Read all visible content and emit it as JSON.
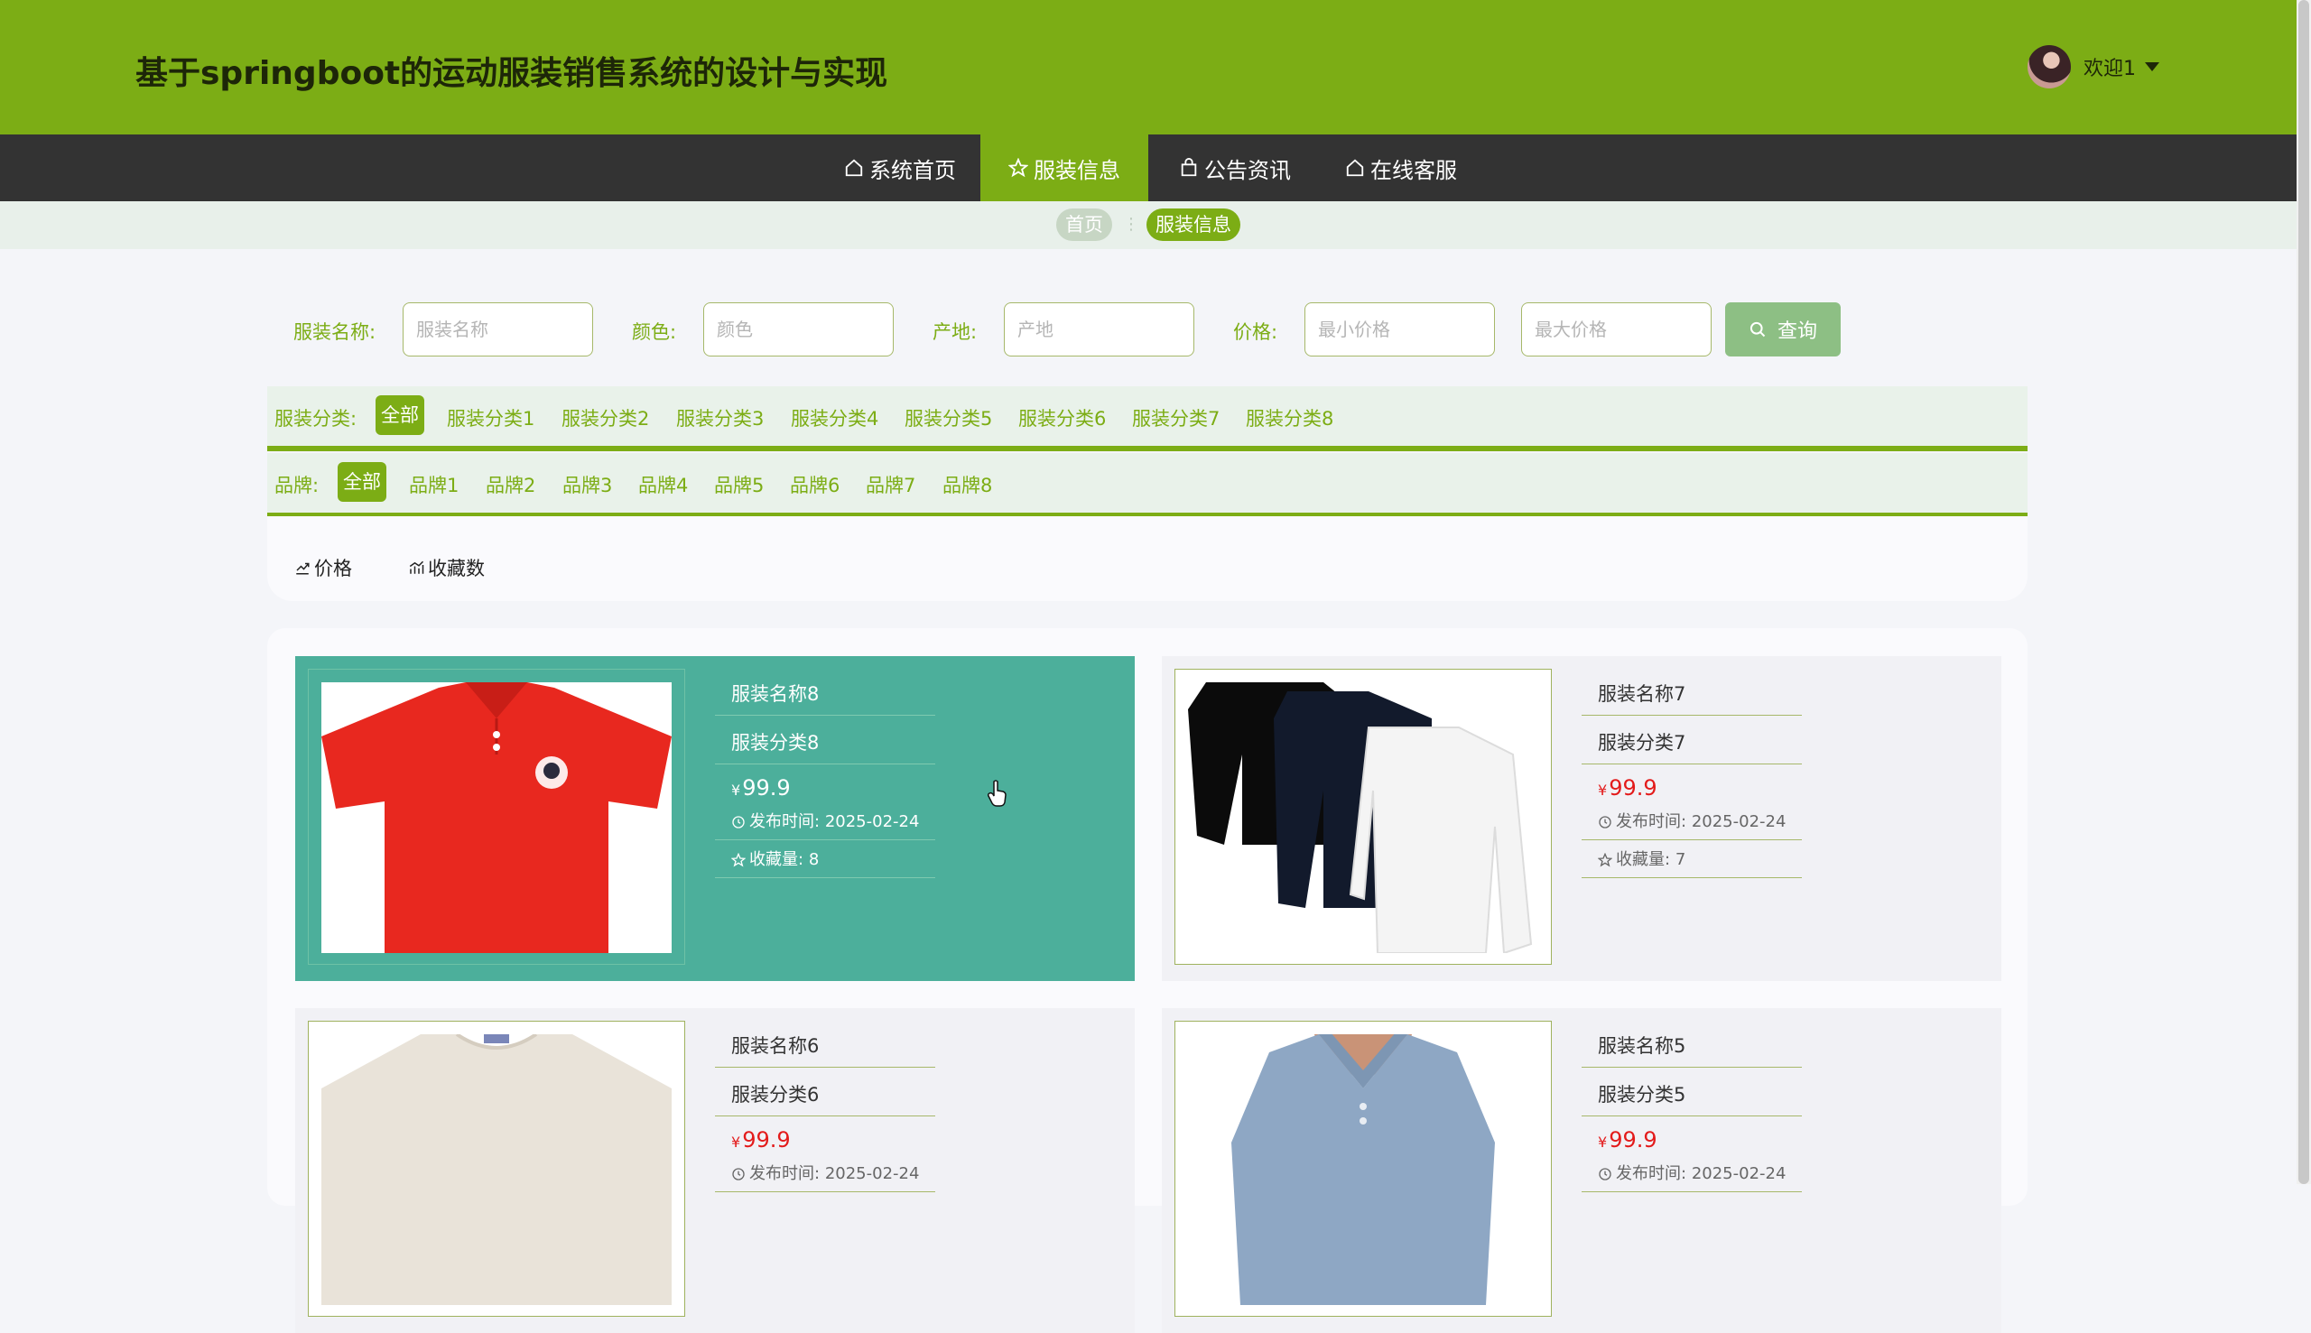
{
  "header": {
    "title": "基于springboot的运动服装销售系统的设计与实现",
    "welcome": "欢迎1"
  },
  "nav": [
    {
      "label": "系统首页",
      "icon": "home-icon"
    },
    {
      "label": "服装信息",
      "icon": "star-icon",
      "active": true
    },
    {
      "label": "公告资讯",
      "icon": "bag-icon"
    },
    {
      "label": "在线客服",
      "icon": "home-icon"
    }
  ],
  "breadcrumb": {
    "home": "首页",
    "current": "服装信息"
  },
  "search": {
    "name_label": "服装名称:",
    "name_placeholder": "服装名称",
    "color_label": "颜色:",
    "color_placeholder": "颜色",
    "origin_label": "产地:",
    "origin_placeholder": "产地",
    "price_label": "价格:",
    "min_placeholder": "最小价格",
    "max_placeholder": "最大价格",
    "button": "查询"
  },
  "category_filter": {
    "label": "服装分类:",
    "options": [
      "全部",
      "服装分类1",
      "服装分类2",
      "服装分类3",
      "服装分类4",
      "服装分类5",
      "服装分类6",
      "服装分类7",
      "服装分类8"
    ],
    "selected": "全部"
  },
  "brand_filter": {
    "label": "品牌:",
    "options": [
      "全部",
      "品牌1",
      "品牌2",
      "品牌3",
      "品牌4",
      "品牌5",
      "品牌6",
      "品牌7",
      "品牌8"
    ],
    "selected": "全部"
  },
  "sort": {
    "price": "价格",
    "favorites": "收藏数"
  },
  "products": [
    {
      "name": "服装名称8",
      "category": "服装分类8",
      "currency": "¥",
      "price": "99.9",
      "time_label": "发布时间:",
      "time": "2025-02-24",
      "fav_label": "收藏量:",
      "fav": "8",
      "image": "red-polo-shirt",
      "accent": "#e8281f"
    },
    {
      "name": "服装名称7",
      "category": "服装分类7",
      "currency": "¥",
      "price": "99.9",
      "time_label": "发布时间:",
      "time": "2025-02-24",
      "fav_label": "收藏量:",
      "fav": "7",
      "image": "long-sleeve-shirts",
      "accent": "#111111"
    },
    {
      "name": "服装名称6",
      "category": "服装分类6",
      "currency": "¥",
      "price": "99.9",
      "time_label": "发布时间:",
      "time": "2025-02-24",
      "fav_label": "",
      "fav": "",
      "image": "beige-tshirt",
      "accent": "#e9e3d9"
    },
    {
      "name": "服装名称5",
      "category": "服装分类5",
      "currency": "¥",
      "price": "99.9",
      "time_label": "发布时间:",
      "time": "2025-02-24",
      "fav_label": "",
      "fav": "",
      "image": "blue-polo-shirt",
      "accent": "#8ea7c4"
    }
  ],
  "colors": {
    "brand": "#7cad15",
    "hover_card": "#4caf9b",
    "price": "#e31b1b",
    "nav_bg": "#333333"
  }
}
